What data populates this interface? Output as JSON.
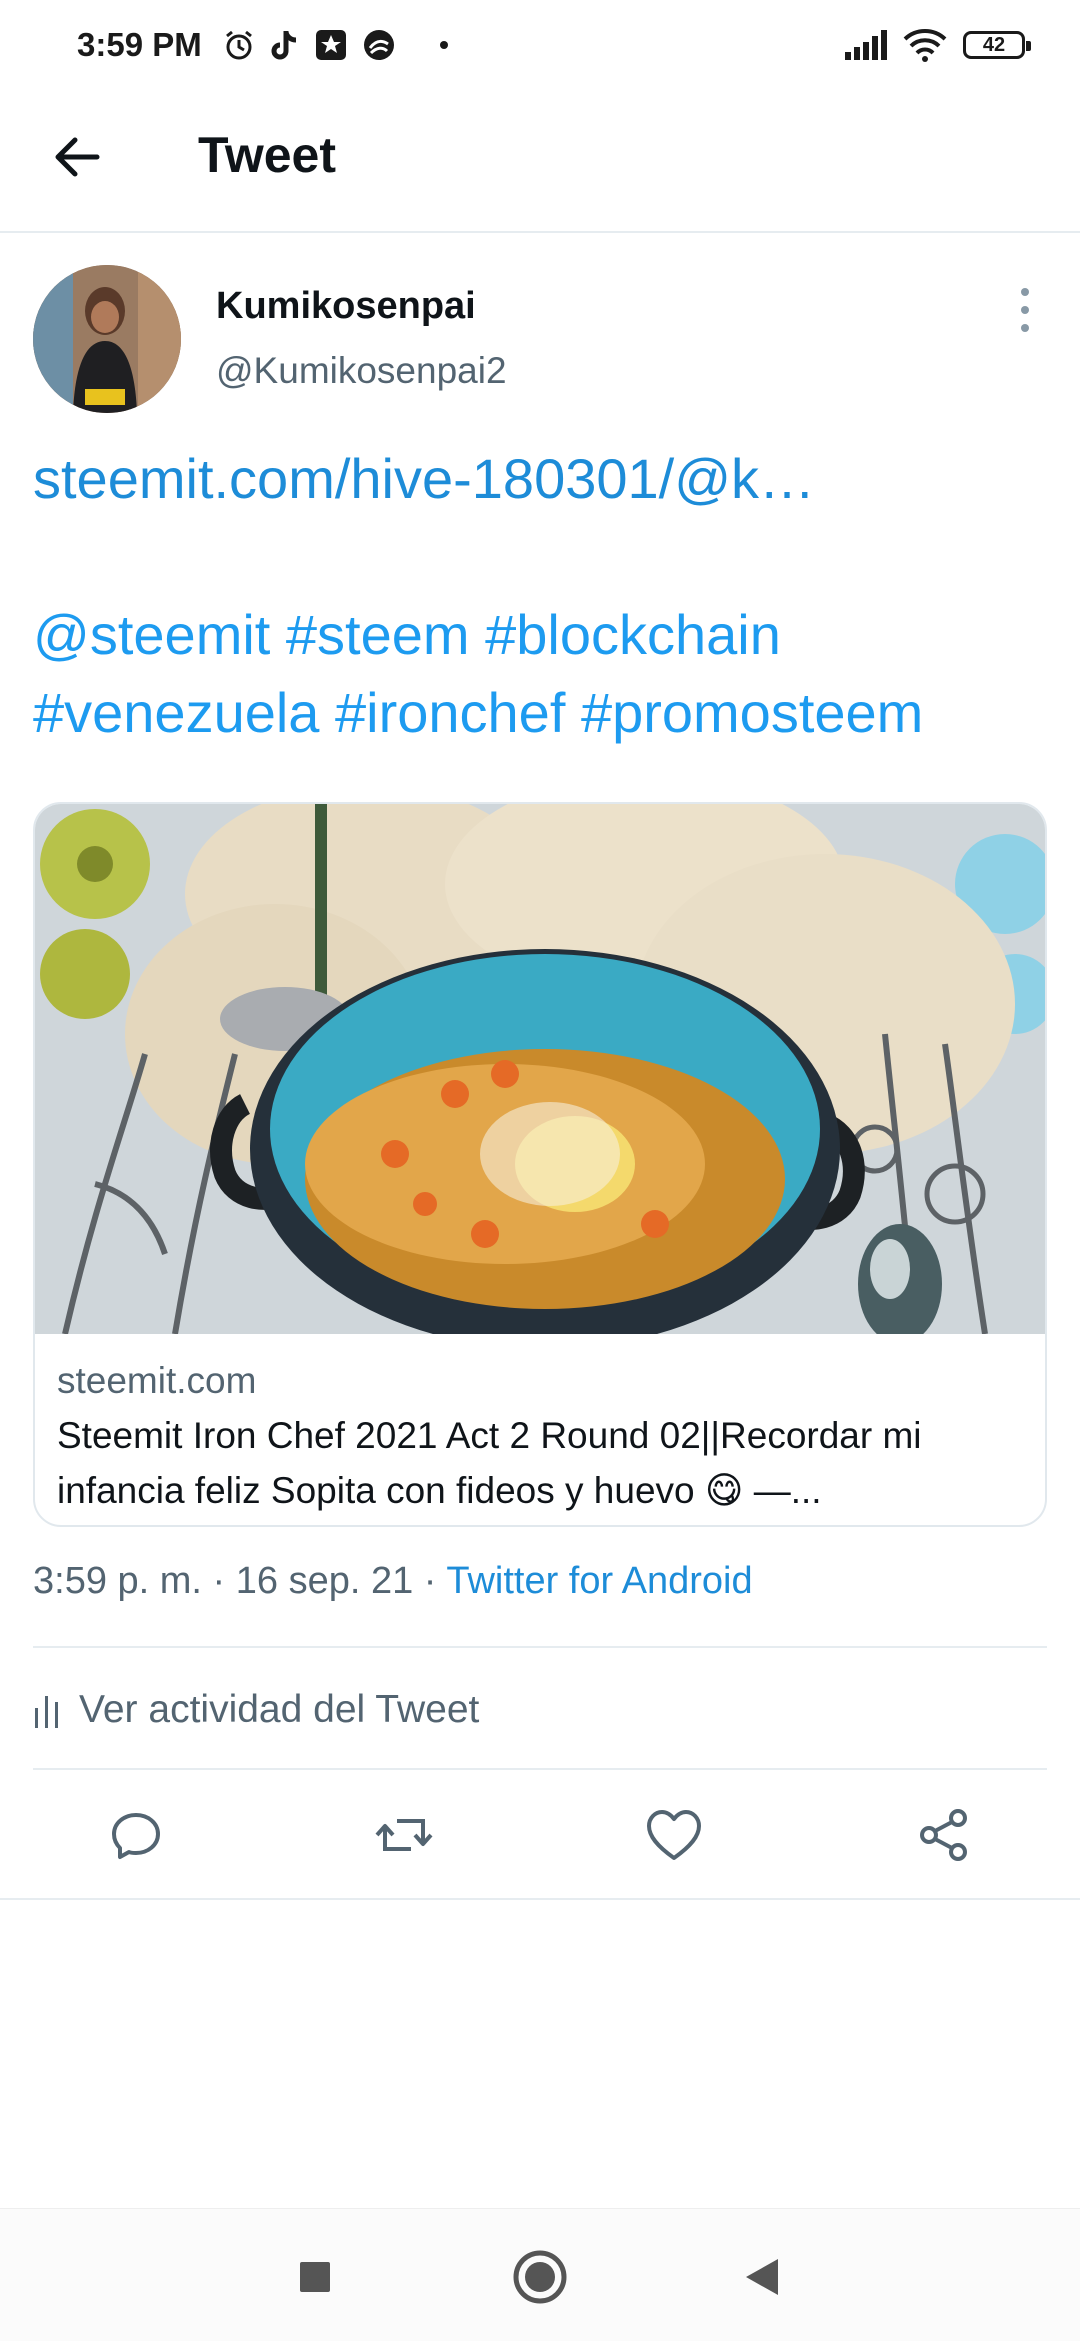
{
  "status_bar": {
    "time": "3:59 PM",
    "icons_left": [
      "alarm-icon",
      "tiktok-icon",
      "app-star-icon",
      "app-circle-icon",
      "dot-icon"
    ],
    "icons_right": [
      "signal-icon",
      "wifi-icon",
      "battery-icon"
    ],
    "battery": "42"
  },
  "header": {
    "title": "Tweet",
    "back_icon": "arrow-left-icon"
  },
  "author": {
    "name": "Kumikosenpai",
    "handle": "@Kumikosenpai2"
  },
  "tweet": {
    "lines": [
      "steemit.com/hive-180301/@k…",
      "",
      "@steemit #steem #blockchain",
      "#venezuela #ironchef #promosteem"
    ]
  },
  "card": {
    "domain": "steemit.com",
    "title_lines": [
      "Steemit Iron Chef 2021 Act 2 Round 02||Recordar mi",
      "infancia feliz Sopita con fideos y huevo 😋 —..."
    ]
  },
  "meta": {
    "time": "3:59 p. m.",
    "separator": " · ",
    "date": "16 sep. 21",
    "source": "Twitter for Android"
  },
  "activity": {
    "label": "Ver actividad del Tweet",
    "icon": "bar-chart-icon"
  },
  "actions": [
    "reply-icon",
    "retweet-icon",
    "like-icon",
    "share-icon"
  ],
  "nav": [
    "recents-square-icon",
    "home-circle-icon",
    "back-triangle-icon"
  ],
  "colors": {
    "link": "#1d8cd8",
    "secondary": "#536471",
    "divider": "#e6ecf0"
  }
}
